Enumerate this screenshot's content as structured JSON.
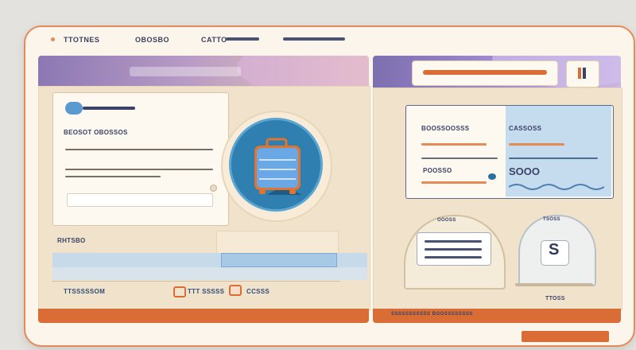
{
  "topbar": {
    "brand": "TTOTNES",
    "nav_1": "OBOSBO",
    "nav_2": "CATTO"
  },
  "left_panel": {
    "section_title": "BEOSOT OBOSSOS",
    "list_title": "RHTSBO",
    "tabs": [
      {
        "label": "TTSSSSSOM"
      },
      {
        "label": "TTT SSSSS"
      },
      {
        "label": "CCSSS"
      }
    ],
    "icon_center": "luggage-icon"
  },
  "right_panel": {
    "search_value": "",
    "toggle_icon": "split-icon",
    "info_card": {
      "left_heading": "BOOSSOOSSS",
      "left_value": "POOSSO",
      "right_heading": "CASSOSS",
      "right_value": "SOOO"
    },
    "dome_left_label": "OOOSS",
    "dome_right_label": "TTOSS",
    "dome_right_glyph": "S",
    "dome_right_caption": "TSOSS",
    "footer_text": "SSSSSSSSSSS BOOSSSSSSSS"
  },
  "colors": {
    "accent_orange": "#d96d35",
    "accent_blue": "#2f7fb0",
    "panel_bg": "#f1e3cb",
    "frame_border": "#e58a5c"
  }
}
